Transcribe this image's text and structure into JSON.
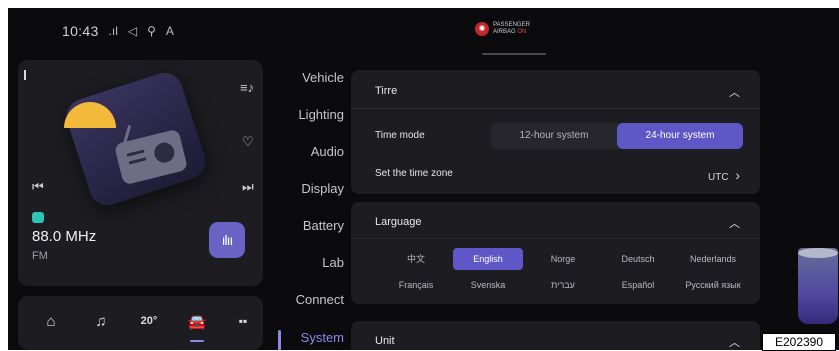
{
  "status_bar": {
    "time": "10:43",
    "signal_icon": ".ıl",
    "nav_icon": "◁",
    "mic_icon": "⚲",
    "user_icon": "A"
  },
  "airbag": {
    "line1": "PASSENGER",
    "line2_a": "AIRBAG",
    "line2_b": "ON",
    "icon": "✺"
  },
  "media": {
    "frequency": "88.0 MHz",
    "band": "FM",
    "icons": {
      "playlist": "≡♪",
      "favorite": "♡",
      "prev": "⏮",
      "next": "⏭",
      "visualizer": "ılıı"
    }
  },
  "dock": {
    "home": "⌂",
    "music": "♫",
    "temp": "20°",
    "car": "🚘",
    "apps": "▪▪"
  },
  "nav": {
    "items": [
      "Vehicle",
      "Lighting",
      "Audio",
      "Display",
      "Battery",
      "Lab",
      "Connect",
      "System"
    ],
    "selected": "System"
  },
  "time_panel": {
    "title": "Tirre",
    "chev": "︿",
    "time_mode_label": "Time mode",
    "options": [
      "12-hour system",
      "24-hour system"
    ],
    "selected_option": "24-hour system",
    "timezone_label": "Set the time zone",
    "timezone_value": "UTC",
    "timezone_chev": "›"
  },
  "language_panel": {
    "title": "Larguage",
    "chev": "︿",
    "languages": [
      "中文",
      "English",
      "Norge",
      "Deutsch",
      "Nederlands",
      "Français",
      "Svenska",
      "עברית",
      "Español",
      "Русский язык"
    ],
    "selected": "English"
  },
  "unit_panel": {
    "title": "Unit",
    "chev": "︿"
  },
  "figure_code": "E202390"
}
